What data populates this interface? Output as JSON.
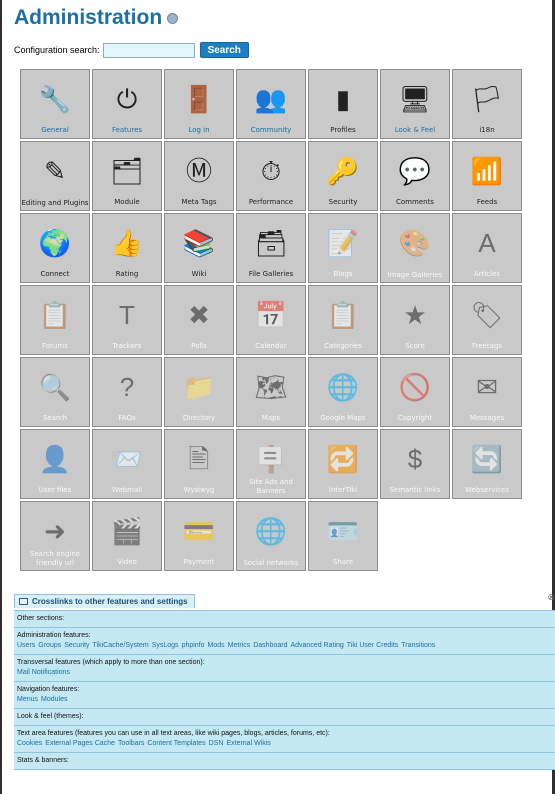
{
  "page": {
    "title": "Administration"
  },
  "search": {
    "label": "Configuration search:",
    "value": "",
    "button": "Search"
  },
  "tiles": [
    {
      "label": "General",
      "icon": "tools-icon",
      "glyph": "🔧",
      "state": "link"
    },
    {
      "label": "Features",
      "icon": "power-icon",
      "glyph": "⏻",
      "state": "link"
    },
    {
      "label": "Log in",
      "icon": "door-icon",
      "glyph": "🚪",
      "state": "link"
    },
    {
      "label": "Community",
      "icon": "community-icon",
      "glyph": "👥",
      "state": "link"
    },
    {
      "label": "Profiles",
      "icon": "profiles-icon",
      "glyph": "▮",
      "state": "enabled"
    },
    {
      "label": "Look & Feel",
      "icon": "look-feel-icon",
      "glyph": "🖥",
      "state": "link"
    },
    {
      "label": "i18n",
      "icon": "flag-icon",
      "glyph": "🏳",
      "state": "enabled"
    },
    {
      "label": "Editing and Plugins",
      "icon": "edit-icon",
      "glyph": "✎",
      "state": "enabled"
    },
    {
      "label": "Module",
      "icon": "module-icon",
      "glyph": "🗂",
      "state": "enabled"
    },
    {
      "label": "Meta Tags",
      "icon": "meta-tags-icon",
      "glyph": "Ⓜ",
      "state": "enabled"
    },
    {
      "label": "Performance",
      "icon": "stopwatch-icon",
      "glyph": "⏱",
      "state": "enabled"
    },
    {
      "label": "Security",
      "icon": "key-icon",
      "glyph": "🔑",
      "state": "enabled"
    },
    {
      "label": "Comments",
      "icon": "speech-bubble-icon",
      "glyph": "💬",
      "state": "enabled"
    },
    {
      "label": "Feeds",
      "icon": "rss-icon",
      "glyph": "📶",
      "state": "enabled"
    },
    {
      "label": "Connect",
      "icon": "connect-icon",
      "glyph": "🌍",
      "state": "enabled"
    },
    {
      "label": "Rating",
      "icon": "rating-icon",
      "glyph": "👍",
      "state": "enabled"
    },
    {
      "label": "Wiki",
      "icon": "wiki-icon",
      "glyph": "📚",
      "state": "enabled"
    },
    {
      "label": "File Galleries",
      "icon": "file-galleries-icon",
      "glyph": "🗃",
      "state": "enabled"
    },
    {
      "label": "Blogs",
      "icon": "blogs-icon",
      "glyph": "📝",
      "state": "disabled"
    },
    {
      "label": "Image Galleries",
      "icon": "palette-icon",
      "glyph": "🎨",
      "state": "disabled"
    },
    {
      "label": "Articles",
      "icon": "articles-icon",
      "glyph": "A",
      "state": "disabled"
    },
    {
      "label": "Forums",
      "icon": "forums-icon",
      "glyph": "📋",
      "state": "disabled"
    },
    {
      "label": "Trackers",
      "icon": "trackers-icon",
      "glyph": "T",
      "state": "disabled"
    },
    {
      "label": "Polls",
      "icon": "polls-icon",
      "glyph": "✖",
      "state": "disabled"
    },
    {
      "label": "Calendar",
      "icon": "calendar-icon",
      "glyph": "📅",
      "state": "disabled"
    },
    {
      "label": "Categories",
      "icon": "categories-icon",
      "glyph": "📋",
      "state": "disabled"
    },
    {
      "label": "Score",
      "icon": "stars-icon",
      "glyph": "★",
      "state": "disabled"
    },
    {
      "label": "Freetags",
      "icon": "tag-icon",
      "glyph": "🏷",
      "state": "disabled"
    },
    {
      "label": "Search",
      "icon": "magnifier-icon",
      "glyph": "🔍",
      "state": "disabled"
    },
    {
      "label": "FAQs",
      "icon": "question-icon",
      "glyph": "?",
      "state": "disabled"
    },
    {
      "label": "Directory",
      "icon": "directory-icon",
      "glyph": "📁",
      "state": "disabled"
    },
    {
      "label": "Maps",
      "icon": "map-icon",
      "glyph": "🗺",
      "state": "disabled"
    },
    {
      "label": "Google Maps",
      "icon": "google-maps-icon",
      "glyph": "🌐",
      "state": "disabled"
    },
    {
      "label": "Copyright",
      "icon": "prohibited-icon",
      "glyph": "🚫",
      "state": "disabled"
    },
    {
      "label": "Messages",
      "icon": "messages-icon",
      "glyph": "✉",
      "state": "disabled"
    },
    {
      "label": "User files",
      "icon": "user-files-icon",
      "glyph": "👤",
      "state": "disabled"
    },
    {
      "label": "Webmail",
      "icon": "webmail-icon",
      "glyph": "📨",
      "state": "disabled"
    },
    {
      "label": "Wysiwyg",
      "icon": "wysiwyg-icon",
      "glyph": "🖹",
      "state": "disabled"
    },
    {
      "label": "Site Ads and Banners",
      "icon": "banners-icon",
      "glyph": "🪧",
      "state": "disabled"
    },
    {
      "label": "InterTiki",
      "icon": "intertiki-icon",
      "glyph": "🔁",
      "state": "disabled"
    },
    {
      "label": "Semantic links",
      "icon": "semantic-links-icon",
      "glyph": "$",
      "state": "disabled"
    },
    {
      "label": "Webservices",
      "icon": "webservices-icon",
      "glyph": "🔄",
      "state": "disabled"
    },
    {
      "label": "Search engine friendly url",
      "icon": "search-engine-icon",
      "glyph": "➜",
      "state": "disabled"
    },
    {
      "label": "Video",
      "icon": "video-icon",
      "glyph": "🎬",
      "state": "disabled"
    },
    {
      "label": "Payment",
      "icon": "payment-icon",
      "glyph": "💳",
      "state": "disabled"
    },
    {
      "label": "Social networks",
      "icon": "social-networks-icon",
      "glyph": "🌐",
      "state": "disabled"
    },
    {
      "label": "Share",
      "icon": "share-icon",
      "glyph": "🪪",
      "state": "disabled"
    }
  ],
  "crosslinks": {
    "tab": "Crosslinks to other features and settings",
    "close": "⊗",
    "sections": [
      {
        "title": "Other sections:",
        "links": []
      },
      {
        "title": "Administration features:",
        "links": [
          "Users",
          "Groups",
          "Security",
          "TikiCache/System",
          "SysLogs",
          "phpinfo",
          "Mods",
          "Metrics",
          "Dashboard",
          "Advanced Rating",
          "Tiki User Credits",
          "Transitions"
        ]
      },
      {
        "title": "Transversal features (which apply to more than one section):",
        "links": [
          "Mail Notifications"
        ]
      },
      {
        "title": "Navigation features:",
        "links": [
          "Menus",
          "Modules"
        ]
      },
      {
        "title": "Look & feel (themes):",
        "links": []
      },
      {
        "title": "Text area features (features you can use in all text areas, like wiki pages, blogs, articles, forums, etc):",
        "links": [
          "Cookies",
          "External Pages Cache",
          "Toolbars",
          "Content Templates",
          "DSN",
          "External Wikis"
        ]
      },
      {
        "title": "Stats & banners:",
        "links": []
      }
    ]
  }
}
